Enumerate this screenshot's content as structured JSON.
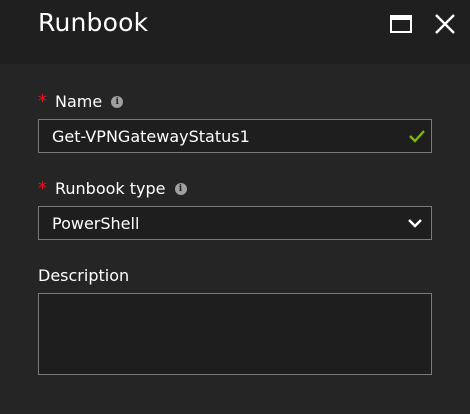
{
  "header": {
    "title": "Runbook",
    "maximize_icon": "maximize-icon",
    "close_icon": "close-icon"
  },
  "form": {
    "name": {
      "required_marker": "*",
      "label": "Name",
      "info_icon": "info-icon",
      "value": "Get-VPNGatewayStatus1",
      "valid_icon": "checkmark-icon"
    },
    "runbook_type": {
      "required_marker": "*",
      "label": "Runbook type",
      "info_icon": "info-icon",
      "selected": "PowerShell",
      "dropdown_icon": "chevron-down-icon"
    },
    "description": {
      "label": "Description",
      "value": ""
    }
  },
  "colors": {
    "background": "#252525",
    "header_background": "#1f1f1f",
    "required": "#e81123",
    "valid": "#7fba00",
    "border": "#7a7a7a"
  }
}
